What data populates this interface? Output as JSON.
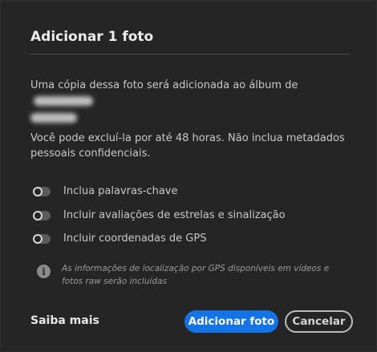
{
  "dialog": {
    "title": "Adicionar 1 foto",
    "copy_text": "Uma cópia dessa foto será adicionada ao álbum de",
    "delete_text": "Você pode excluí-la por até 48 horas. Não inclua metadados pessoais confidenciais."
  },
  "options": [
    {
      "label": "Inclua palavras-chave",
      "on": false
    },
    {
      "label": "Incluir avaliações de estrelas e sinalização",
      "on": false
    },
    {
      "label": "Incluir coordenadas de GPS",
      "on": false
    }
  ],
  "info": {
    "icon": "info-icon",
    "text": "As informações de localização por GPS disponíveis em vídeos e fotos raw serão incluídas"
  },
  "footer": {
    "learn_more": "Saiba mais",
    "add_button": "Adicionar foto",
    "cancel_button": "Cancelar"
  },
  "colors": {
    "background": "#252525",
    "primary": "#1473e6"
  }
}
